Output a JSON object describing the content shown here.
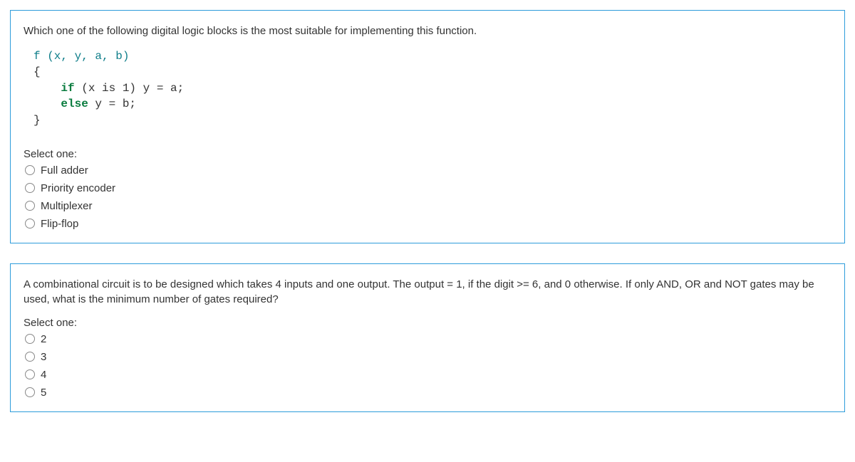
{
  "questions": [
    {
      "prompt": "Which one of the following digital logic blocks is the most suitable for implementing this function.",
      "code": {
        "line1_sig": "f (x, y, a, b)",
        "line2": "{",
        "line3_kw": "if",
        "line3_rest": " (x is 1) y = a;",
        "line4_kw": "else",
        "line4_rest": " y = b;",
        "line5": "}"
      },
      "selectLabel": "Select one:",
      "options": [
        {
          "label": "Full adder"
        },
        {
          "label": "Priority encoder"
        },
        {
          "label": "Multiplexer"
        },
        {
          "label": "Flip-flop"
        }
      ]
    },
    {
      "prompt": "A combinational circuit is to be designed which takes 4 inputs and one output. The output = 1, if the digit >= 6, and 0 otherwise. If only AND, OR and NOT gates may be used, what is the minimum number of gates required?",
      "selectLabel": "Select one:",
      "options": [
        {
          "label": "2"
        },
        {
          "label": "3"
        },
        {
          "label": "4"
        },
        {
          "label": "5"
        }
      ]
    }
  ]
}
